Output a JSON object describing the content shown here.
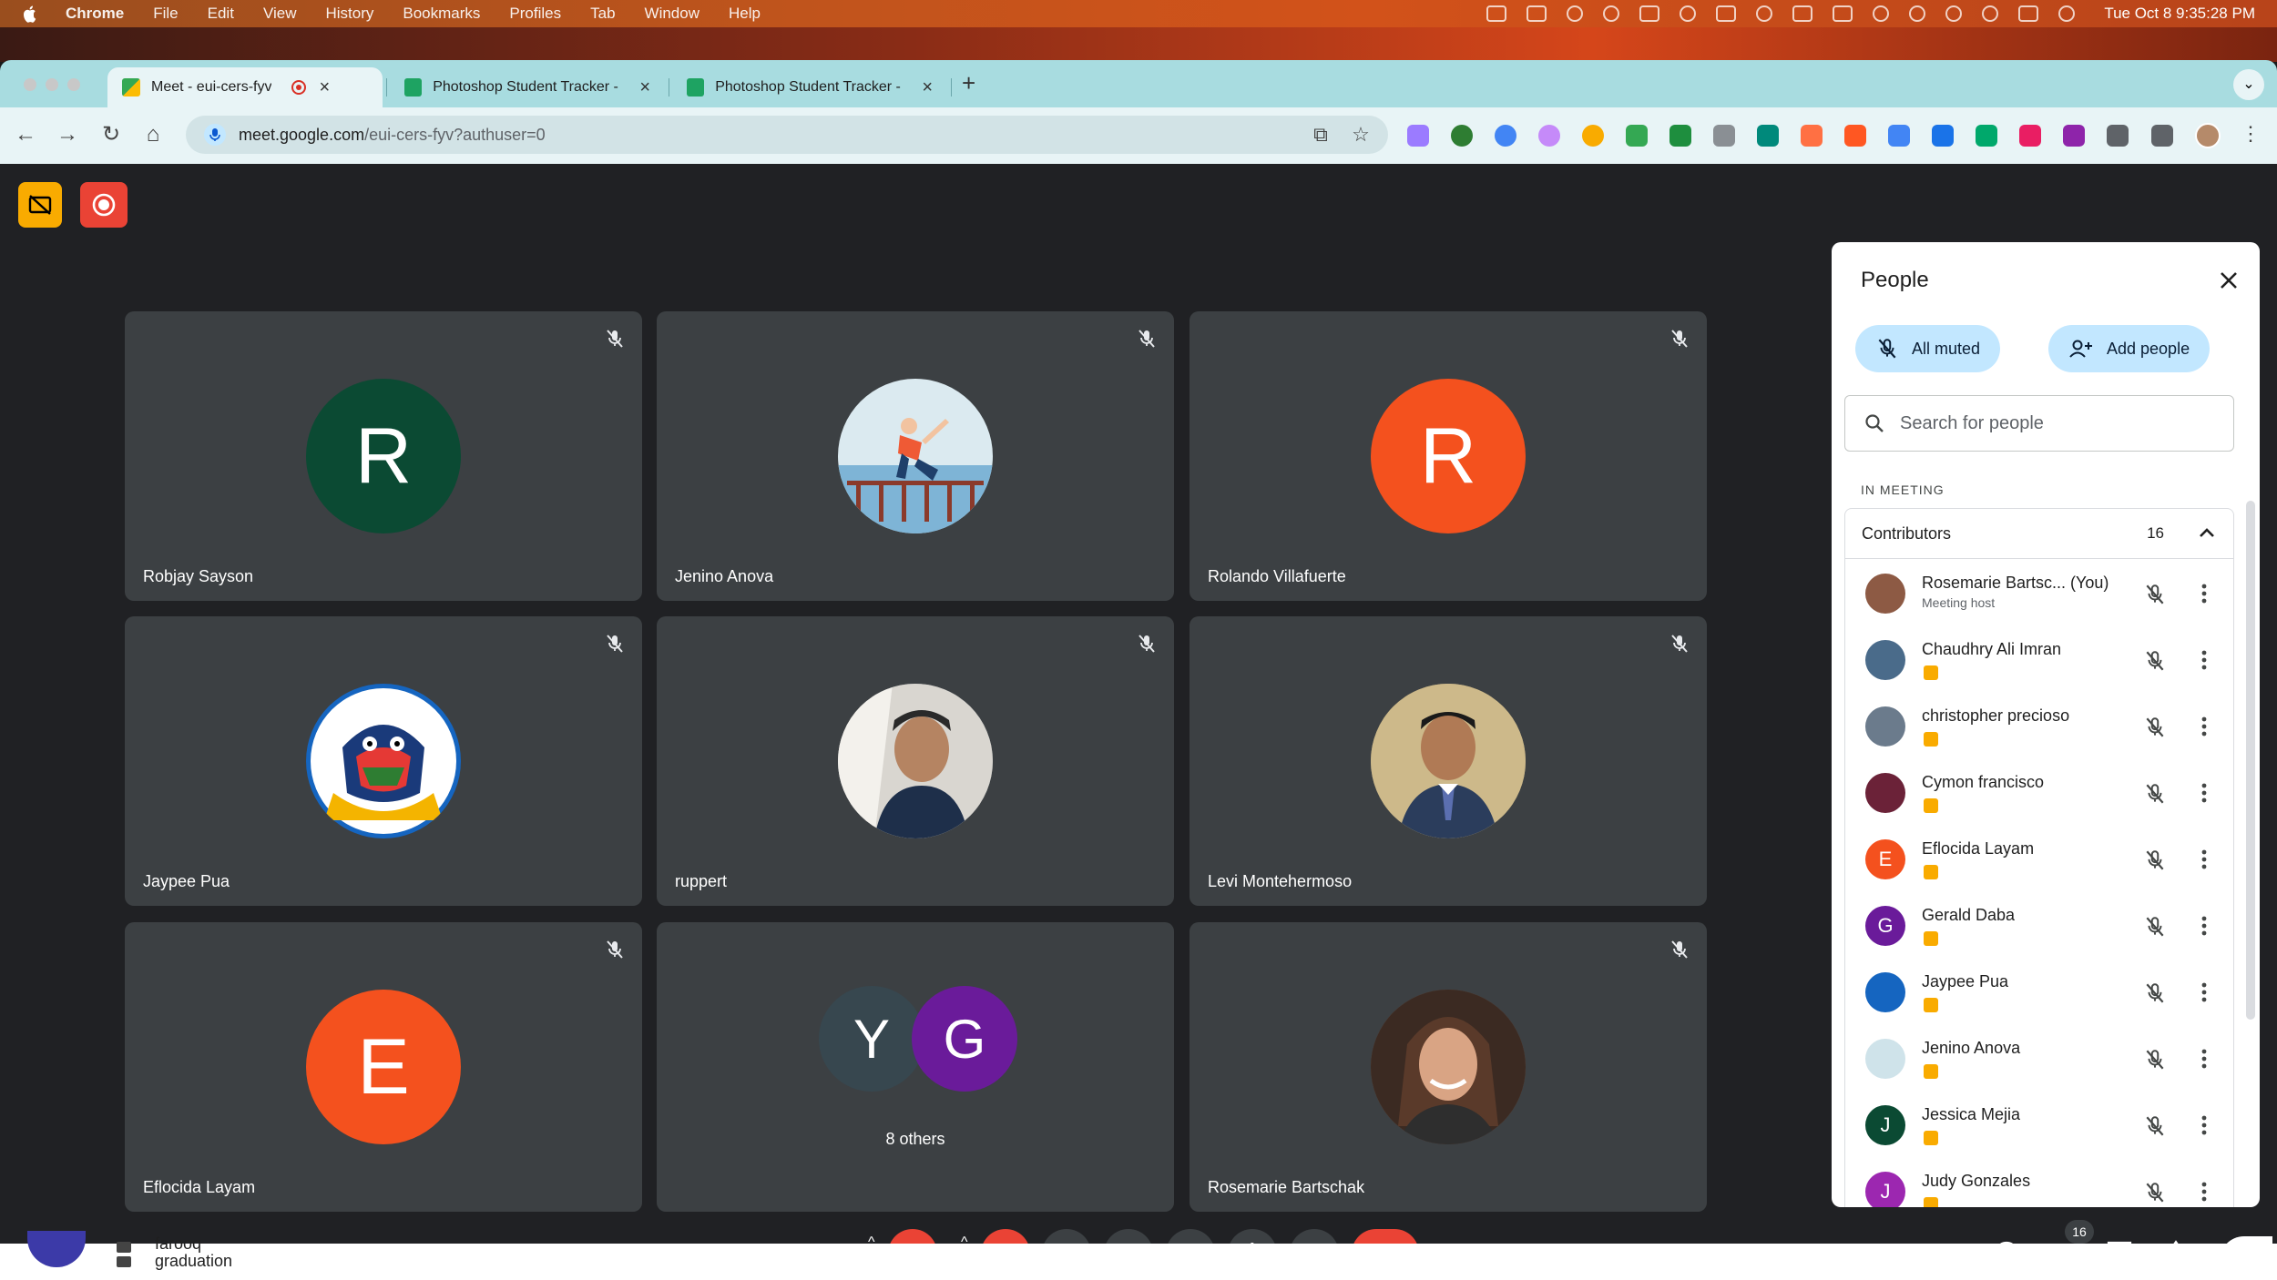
{
  "menubar": {
    "app": "Chrome",
    "items": [
      "File",
      "Edit",
      "View",
      "History",
      "Bookmarks",
      "Profiles",
      "Tab",
      "Window",
      "Help"
    ],
    "clock": "Tue Oct 8  9:35:28 PM"
  },
  "browser": {
    "tabs": [
      {
        "title": "Meet - eui-cers-fyv",
        "active": true,
        "icon": "meet-icon"
      },
      {
        "title": "Photoshop Student Tracker -",
        "active": false,
        "icon": "sheets-icon"
      },
      {
        "title": "Photoshop Student Tracker -",
        "active": false,
        "icon": "sheets-icon"
      }
    ],
    "url_host": "meet.google.com",
    "url_path": "/eui-cers-fyv?authuser=0"
  },
  "meeting": {
    "code": "eui-cers-fyv",
    "tiles": [
      {
        "name": "Robjay Sayson",
        "initial": "R",
        "color": "#0b4a33"
      },
      {
        "name": "Jenino Anova",
        "initial": "",
        "color": "#cfe3ea"
      },
      {
        "name": "Rolando Villafuerte",
        "initial": "R",
        "color": "#f4511e"
      },
      {
        "name": "Jaypee Pua",
        "initial": "",
        "color": "#1565c0"
      },
      {
        "name": "ruppert",
        "initial": "",
        "color": "#7a7f84"
      },
      {
        "name": "Levi Montehermoso",
        "initial": "",
        "color": "#c8b27a"
      },
      {
        "name": "Eflocida Layam",
        "initial": "E",
        "color": "#f4511e"
      },
      {
        "name": "8 others",
        "initial": "",
        "color": "#3c4043"
      },
      {
        "name": "Rosemarie Bartschak",
        "initial": "",
        "color": "#7a4f3a"
      }
    ],
    "others": [
      {
        "initial": "Y",
        "color": "#37474f"
      },
      {
        "initial": "G",
        "color": "#6a1b9a"
      }
    ],
    "people_count": "16"
  },
  "people_panel": {
    "title": "People",
    "all_muted": "All muted",
    "add_people": "Add people",
    "search_placeholder": "Search for people",
    "section": "IN MEETING",
    "group": "Contributors",
    "group_count": "16",
    "participants": [
      {
        "name": "Rosemarie Bartsc...  (You)",
        "sub": "Meeting host",
        "initial": "",
        "color": "#8d5a44"
      },
      {
        "name": "Chaudhry Ali Imran",
        "sub": "",
        "initial": "",
        "color": "#4a6b8a"
      },
      {
        "name": "christopher precioso",
        "sub": "",
        "initial": "",
        "color": "#6b7b8c"
      },
      {
        "name": "Cymon francisco",
        "sub": "",
        "initial": "",
        "color": "#6b2238"
      },
      {
        "name": "Eflocida Layam",
        "sub": "",
        "initial": "E",
        "color": "#f4511e"
      },
      {
        "name": "Gerald Daba",
        "sub": "",
        "initial": "G",
        "color": "#6a1b9a"
      },
      {
        "name": "Jaypee Pua",
        "sub": "",
        "initial": "",
        "color": "#1565c0"
      },
      {
        "name": "Jenino Anova",
        "sub": "",
        "initial": "",
        "color": "#cfe3ea"
      },
      {
        "name": "Jessica Mejia",
        "sub": "",
        "initial": "J",
        "color": "#0b4a33"
      },
      {
        "name": "Judy Gonzales",
        "sub": "",
        "initial": "J",
        "color": "#9c27b0"
      }
    ]
  },
  "background_page": {
    "lines": [
      "farooq",
      "graduation"
    ]
  },
  "colors": {
    "meet_bg": "#202124",
    "tile_bg": "#3c4043",
    "danger": "#ea4335",
    "pill": "#c2e7ff"
  }
}
